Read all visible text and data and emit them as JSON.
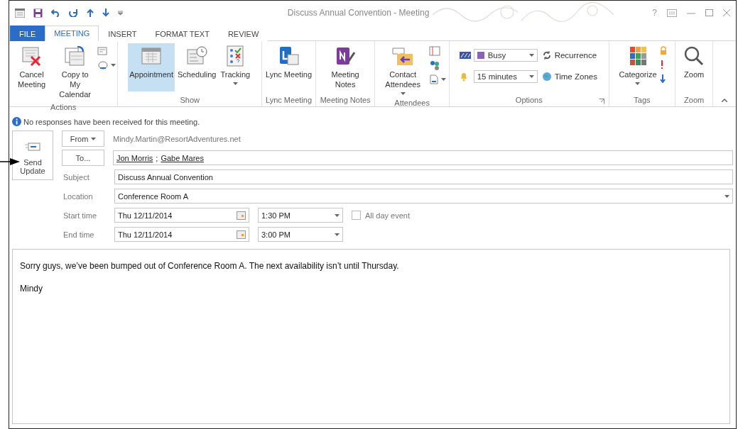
{
  "window": {
    "title": "Discuss Annual Convention - Meeting",
    "help": "?"
  },
  "tabs": [
    {
      "label": "FILE",
      "kind": "file",
      "selected": false
    },
    {
      "label": "MEETING",
      "kind": "tab",
      "selected": true
    },
    {
      "label": "INSERT",
      "kind": "tab",
      "selected": false
    },
    {
      "label": "FORMAT TEXT",
      "kind": "tab",
      "selected": false
    },
    {
      "label": "REVIEW",
      "kind": "tab",
      "selected": false
    }
  ],
  "ribbon": [
    {
      "label": "Actions",
      "kind": "buttons",
      "items": [
        {
          "label": "Cancel Meeting",
          "selected": false,
          "dropdown": false
        },
        {
          "label": "Copy to My Calendar",
          "selected": false,
          "dropdown": false
        }
      ]
    },
    {
      "label": "Show",
      "kind": "buttons",
      "items": [
        {
          "label": "Appointment",
          "selected": true,
          "dropdown": false
        },
        {
          "label": "Scheduling",
          "selected": false,
          "dropdown": false
        },
        {
          "label": "Tracking",
          "selected": false,
          "dropdown": true
        }
      ]
    },
    {
      "label": "Lync Meeting",
      "kind": "buttons",
      "items": [
        {
          "label": "Lync Meeting",
          "selected": false,
          "dropdown": false
        }
      ]
    },
    {
      "label": "Meeting Notes",
      "kind": "buttons",
      "items": [
        {
          "label": "Meeting Notes",
          "selected": false,
          "dropdown": false
        }
      ]
    },
    {
      "label": "Attendees",
      "kind": "buttons",
      "items": [
        {
          "label": "Contact Attendees",
          "selected": false,
          "dropdown": true
        }
      ]
    },
    {
      "label": "Options",
      "kind": "options",
      "show_as": "Busy",
      "reminder": "15 minutes",
      "actions": [
        "Recurrence",
        "Time Zones"
      ]
    },
    {
      "label": "Tags",
      "kind": "buttons",
      "items": [
        {
          "label": "Categorize",
          "selected": false,
          "dropdown": true
        }
      ]
    },
    {
      "label": "Zoom",
      "kind": "buttons",
      "items": [
        {
          "label": "Zoom",
          "selected": false,
          "dropdown": false
        }
      ]
    }
  ],
  "info_bar": "No responses have been received for this meeting.",
  "send_button": "Send Update",
  "from": {
    "button": "From",
    "value": "Mindy.Martin@ResortAdventures.net"
  },
  "to": {
    "button": "To...",
    "recipients": [
      "Jon Morris",
      "Gabe Mares"
    ],
    "separator": ";"
  },
  "subject": {
    "label": "Subject",
    "value": "Discuss Annual Convention"
  },
  "location": {
    "label": "Location",
    "value": "Conference Room A"
  },
  "start": {
    "label": "Start time",
    "date": "Thu 12/11/2014",
    "time": "1:30 PM"
  },
  "all_day": {
    "label": "All day event",
    "checked": false
  },
  "end": {
    "label": "End time",
    "date": "Thu 12/11/2014",
    "time": "3:00 PM"
  },
  "body": [
    "Sorry guys, we’ve been bumped out of Conference Room A. The next availability isn’t until Thursday.",
    "Mindy"
  ]
}
